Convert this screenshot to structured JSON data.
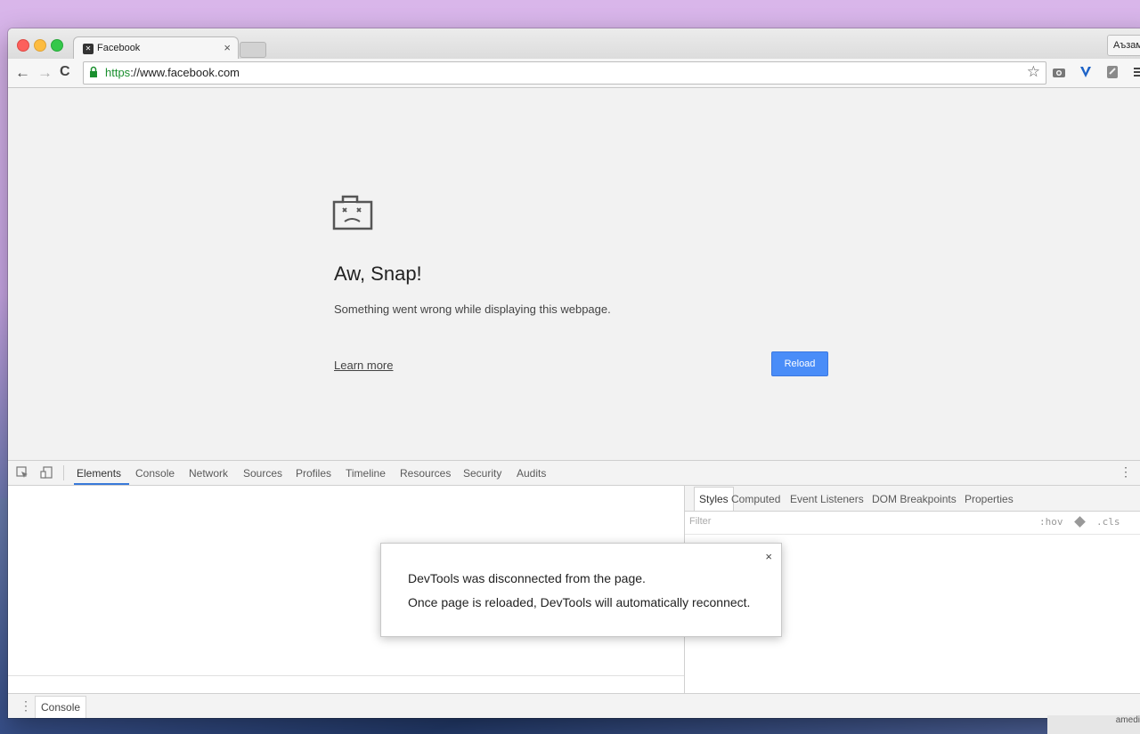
{
  "browser": {
    "tab": {
      "title": "Facebook",
      "close": "×"
    },
    "profile_button": "Аъзам",
    "toolbar": {
      "back": "←",
      "forward": "→",
      "reload": "C"
    },
    "omnibox": {
      "scheme": "https",
      "rest": "://www.facebook.com"
    }
  },
  "page": {
    "title": "Aw, Snap!",
    "message": "Something went wrong while displaying this webpage.",
    "learn_more": "Learn more",
    "reload": "Reload"
  },
  "devtools": {
    "tabs": [
      "Elements",
      "Console",
      "Network",
      "Sources",
      "Profiles",
      "Timeline",
      "Resources",
      "Security",
      "Audits"
    ],
    "active_tab": "Elements",
    "styles_tabs": [
      "Styles",
      "Computed",
      "Event Listeners",
      "DOM Breakpoints",
      "Properties"
    ],
    "filter_placeholder": "Filter",
    "hov": ":hov",
    "cls": ".cls",
    "drawer_tab": "Console"
  },
  "dialog": {
    "line1": "DevTools was disconnected from the page.",
    "line2": "Once page is reloaded, DevTools will automatically reconnect.",
    "close": "×"
  },
  "notification": {
    "text": "amedi"
  }
}
